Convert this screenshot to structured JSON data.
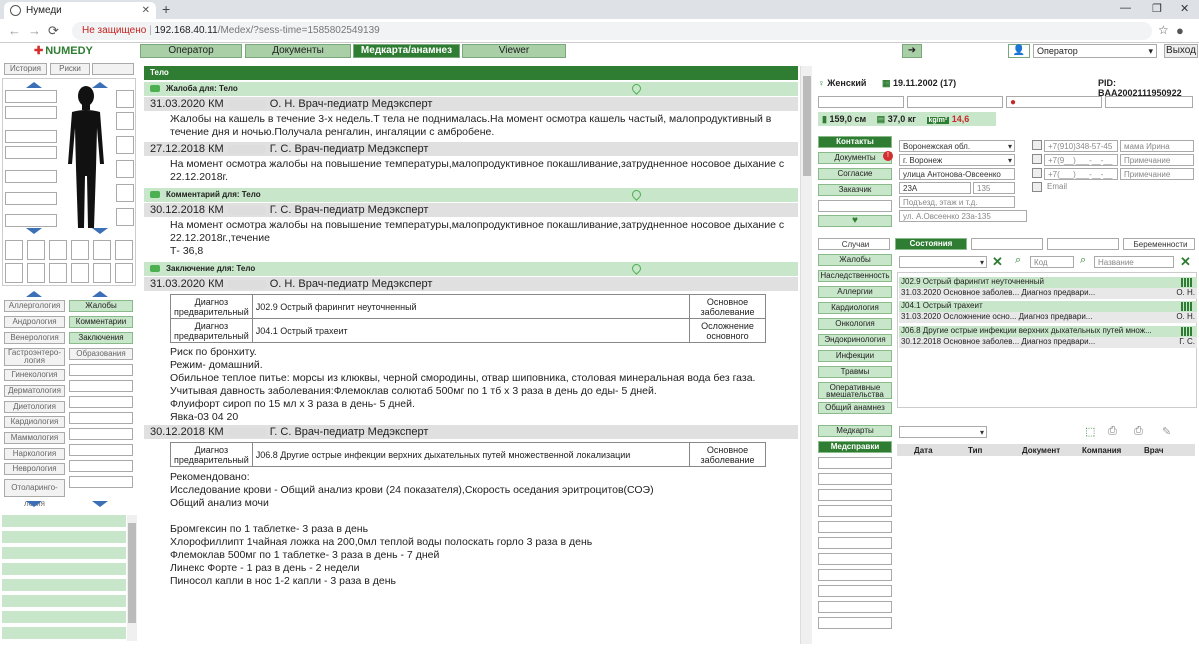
{
  "browser": {
    "tab_title": "Нумеди",
    "tab_close": "✕",
    "new_tab": "+",
    "minimize": "—",
    "maximize": "❐",
    "close": "✕",
    "security_label": "Не защищено",
    "url_host": "192.168.40.11",
    "url_path": "/Medex/?sess-time=1585802549139"
  },
  "app": {
    "logo": "NUMEDY",
    "tabs": [
      "Оператор",
      "Документы",
      "Медкарта/анамнез",
      "Viewer"
    ],
    "active_tab": "Медкарта/анамнез",
    "operator_select": "Оператор",
    "exit": "Выход"
  },
  "left": {
    "buttons_top": [
      "История",
      "Риски"
    ],
    "categories_left": [
      "Аллергология",
      "Андрология",
      "Венерология",
      "Гастроэнтеро-логия",
      "Гинекология",
      "Дерматология",
      "Диетология",
      "Кардиология",
      "Маммология",
      "Наркология",
      "Неврология",
      "Отоларинго- логия"
    ],
    "categories_right": [
      "Жалобы",
      "Комментарии",
      "Заключения",
      "Образования"
    ]
  },
  "main": {
    "section": "Тело",
    "complaint_head": "Жалоба для: Тело",
    "comment_head": "Комментарий для: Тело",
    "conclusion_head": "Заключение для: Тело",
    "entry1_date": "31.03.2020 КМ",
    "entry1_doctor": "О. Н. Врач-педиатр Медэксперт",
    "entry1_text1": "Жалобы на кашель в течение 3-х недель.Т тела не поднималась.На момент осмотра кашель частый, малопродуктивный в",
    "entry1_text2": "течение дня и ночью.Получала ренгалин, ингаляции с амбробене.",
    "entry2_date": "27.12.2018 КМ",
    "entry2_doctor": "Г. С. Врач-педиатр Медэксперт",
    "entry2_text1": "На момент осмотра жалобы на повышение температуры,малопродуктивное покашливание,затрудненное носовое дыхание с",
    "entry2_text2": "22.12.2018г.",
    "comment_date": "30.12.2018 КМ",
    "comment_doctor": "Г. С. Врач-педиатр Медэксперт",
    "comment_text1": "На момент осмотра жалобы на повышение температуры,малопродуктивное покашливание,затрудненное носовое дыхание с",
    "comment_text2": "22.12.2018г.,течение",
    "comment_text3": "Т- 36,8",
    "concl1_date": "31.03.2020 КМ",
    "concl1_doctor": "О. Н. Врач-педиатр Медэксперт",
    "dx_prelim": "Диагноз предварительный",
    "dx1_code": "J02.9 Острый фарингит неуточненный",
    "dx1_type": "Основное заболевание",
    "dx2_code": "J04.1 Острый трахеит",
    "dx2_type": "Осложнение основного",
    "concl1_lines": [
      "Риск по бронхиту.",
      "Режим- домашний.",
      "Обильное теплое питье: морсы из клюквы, черной смородины, отвар шиповника, столовая минеральная вода без газа.",
      "Учитывая давность заболевания:Флемоклав солютаб 500мг по 1 тб х 3 раза в день до еды- 5 дней.",
      "Флуифорт сироп по 15 мл х 3 раза в день- 5 дней.",
      "Явка-03 04 20"
    ],
    "concl2_date": "30.12.2018 КМ",
    "concl2_doctor": "Г. С. Врач-педиатр Медэксперт",
    "dx3_code": "J06.8 Другие острые инфекции верхних дыхательных путей множественной локализации",
    "dx3_type": "Основное заболевание",
    "concl2_lines": [
      "Рекомендовано:",
      "Исследование крови - Общий анализ крови (24 показателя),Скорость оседания эритроцитов(СОЭ)",
      "Общий анализ мочи",
      "",
      "Бромгексин по 1 таблетке- 3 раза в день",
      "Хлорофиллипт 1чайная ложка на 200,0мл теплой воды полоскать горло 3 раза в день",
      "Флемоклав 500мг по 1 таблетке- 3 раза в день - 7 дней",
      "Линекс Форте - 1 раз в день - 2 недели",
      "Пиносол капли в нос 1-2 капли - 3 раза в день"
    ]
  },
  "patient": {
    "sex": "Женский",
    "dob": "19.11.2002 (17)",
    "pid": "PID: BAA2002111950922",
    "height": "159,0 см",
    "weight": "37,0 кг",
    "bmi_label": "kg/m²",
    "bmi": "14,6"
  },
  "contacts": {
    "buttons": [
      "Контакты",
      "Документы",
      "Согласие",
      "Заказчик"
    ],
    "region": "Воронежская обл.",
    "city": "г. Воронеж",
    "street": "улица Антонова-Овсеенко",
    "house": "23А",
    "apt": "135",
    "entrance_ph": "Подъезд, этаж и т.д.",
    "full_addr": "ул. А.Овсеенко 23а-135",
    "phone1": "+7(910)348-57-45",
    "phone1_note": "мама Ирина",
    "phone2": "+7(9__)___-__-__",
    "phone2_note": "Примечание",
    "phone3": "+7(___)___-__-__",
    "phone3_note": "Примечание",
    "email": "Email"
  },
  "history": {
    "tabs": [
      "Случаи",
      "Состояния",
      "Беременности"
    ],
    "buttons": [
      "Жалобы",
      "Наследственность",
      "Аллергии",
      "Кардиология",
      "Онкология",
      "Эндокринология",
      "Инфекции",
      "Травмы",
      "Оперативные вмешательства",
      "Общий анамнез"
    ],
    "code_ph": "Код",
    "name_ph": "Название",
    "items": [
      {
        "title": "J02.9 Острый фарингит неуточненный",
        "date": "31.03.2020",
        "kind": "Основное заболев...",
        "dx": "Диагноз предвари...",
        "doc": "О. Н."
      },
      {
        "title": "J04.1 Острый трахеит",
        "date": "31.03.2020",
        "kind": "Осложнение осно...",
        "dx": "Диагноз предвари...",
        "doc": "О. Н."
      },
      {
        "title": "J06.8 Другие острые инфекции верхних дыхательных путей множ...",
        "date": "30.12.2018",
        "kind": "Основное заболев...",
        "dx": "Диагноз предвари...",
        "doc": "Г. С."
      }
    ]
  },
  "docs": {
    "buttons": [
      "Медкарты",
      "Медсправки"
    ],
    "columns": [
      "Дата",
      "Тип",
      "Документ",
      "Компания",
      "Врач"
    ]
  }
}
